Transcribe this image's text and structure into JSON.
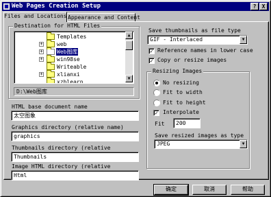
{
  "window": {
    "title": "Web Pages Creation Setup",
    "help_label": "?",
    "close_label": "X"
  },
  "tabs": [
    {
      "label": "Files and Locations",
      "active": true
    },
    {
      "label": "Appearance and Content",
      "active": false
    }
  ],
  "destination": {
    "group_label": "Destination for HTML Files",
    "tree": [
      {
        "label": "Templates",
        "expander": ""
      },
      {
        "label": "web",
        "expander": "+"
      },
      {
        "label": "Web图库",
        "expander": "+",
        "selected": true
      },
      {
        "label": "win98se",
        "expander": "+"
      },
      {
        "label": "Writeable",
        "expander": ""
      },
      {
        "label": "xlianxi",
        "expander": "+"
      },
      {
        "label": "xzblearn",
        "expander": ""
      }
    ],
    "path": "D:\\Web图库",
    "scroll_up": "▲",
    "scroll_down": "▼"
  },
  "fields": {
    "html_base_label": "HTML base document name",
    "html_base_value": "太空图象",
    "graphics_dir_label": "Graphics directory (relative name)",
    "graphics_dir_value": "graphics",
    "thumbs_dir_label": "Thumbnails directory (relative",
    "thumbs_dir_value": "Thumbnails",
    "image_html_dir_label": "Image HTML directory (relative",
    "image_html_dir_value": "Html"
  },
  "thumbnails": {
    "type_label": "Save thumbnails as file type",
    "type_value": "GIF - Interlaced",
    "reference_lower_label": "Reference names in lower case",
    "reference_lower_checked": true,
    "copy_resize_label": "Copy or resize images",
    "copy_resize_checked": true,
    "check_mark": "✓",
    "dropdown_arrow": "▼"
  },
  "resizing": {
    "group_label": "Resizing Images",
    "options": [
      {
        "label": "No resizing",
        "selected": true
      },
      {
        "label": "Fit to width",
        "selected": false
      },
      {
        "label": "Fit to height",
        "selected": false
      }
    ],
    "interpolate_label": "Interpolate",
    "interpolate_checked": true,
    "fit_label": "Fit",
    "fit_value": "200",
    "save_type_label": "Save resized images as type",
    "save_type_value": "JPEG"
  },
  "buttons": {
    "ok": "确定",
    "cancel": "取消",
    "help": "帮助"
  }
}
